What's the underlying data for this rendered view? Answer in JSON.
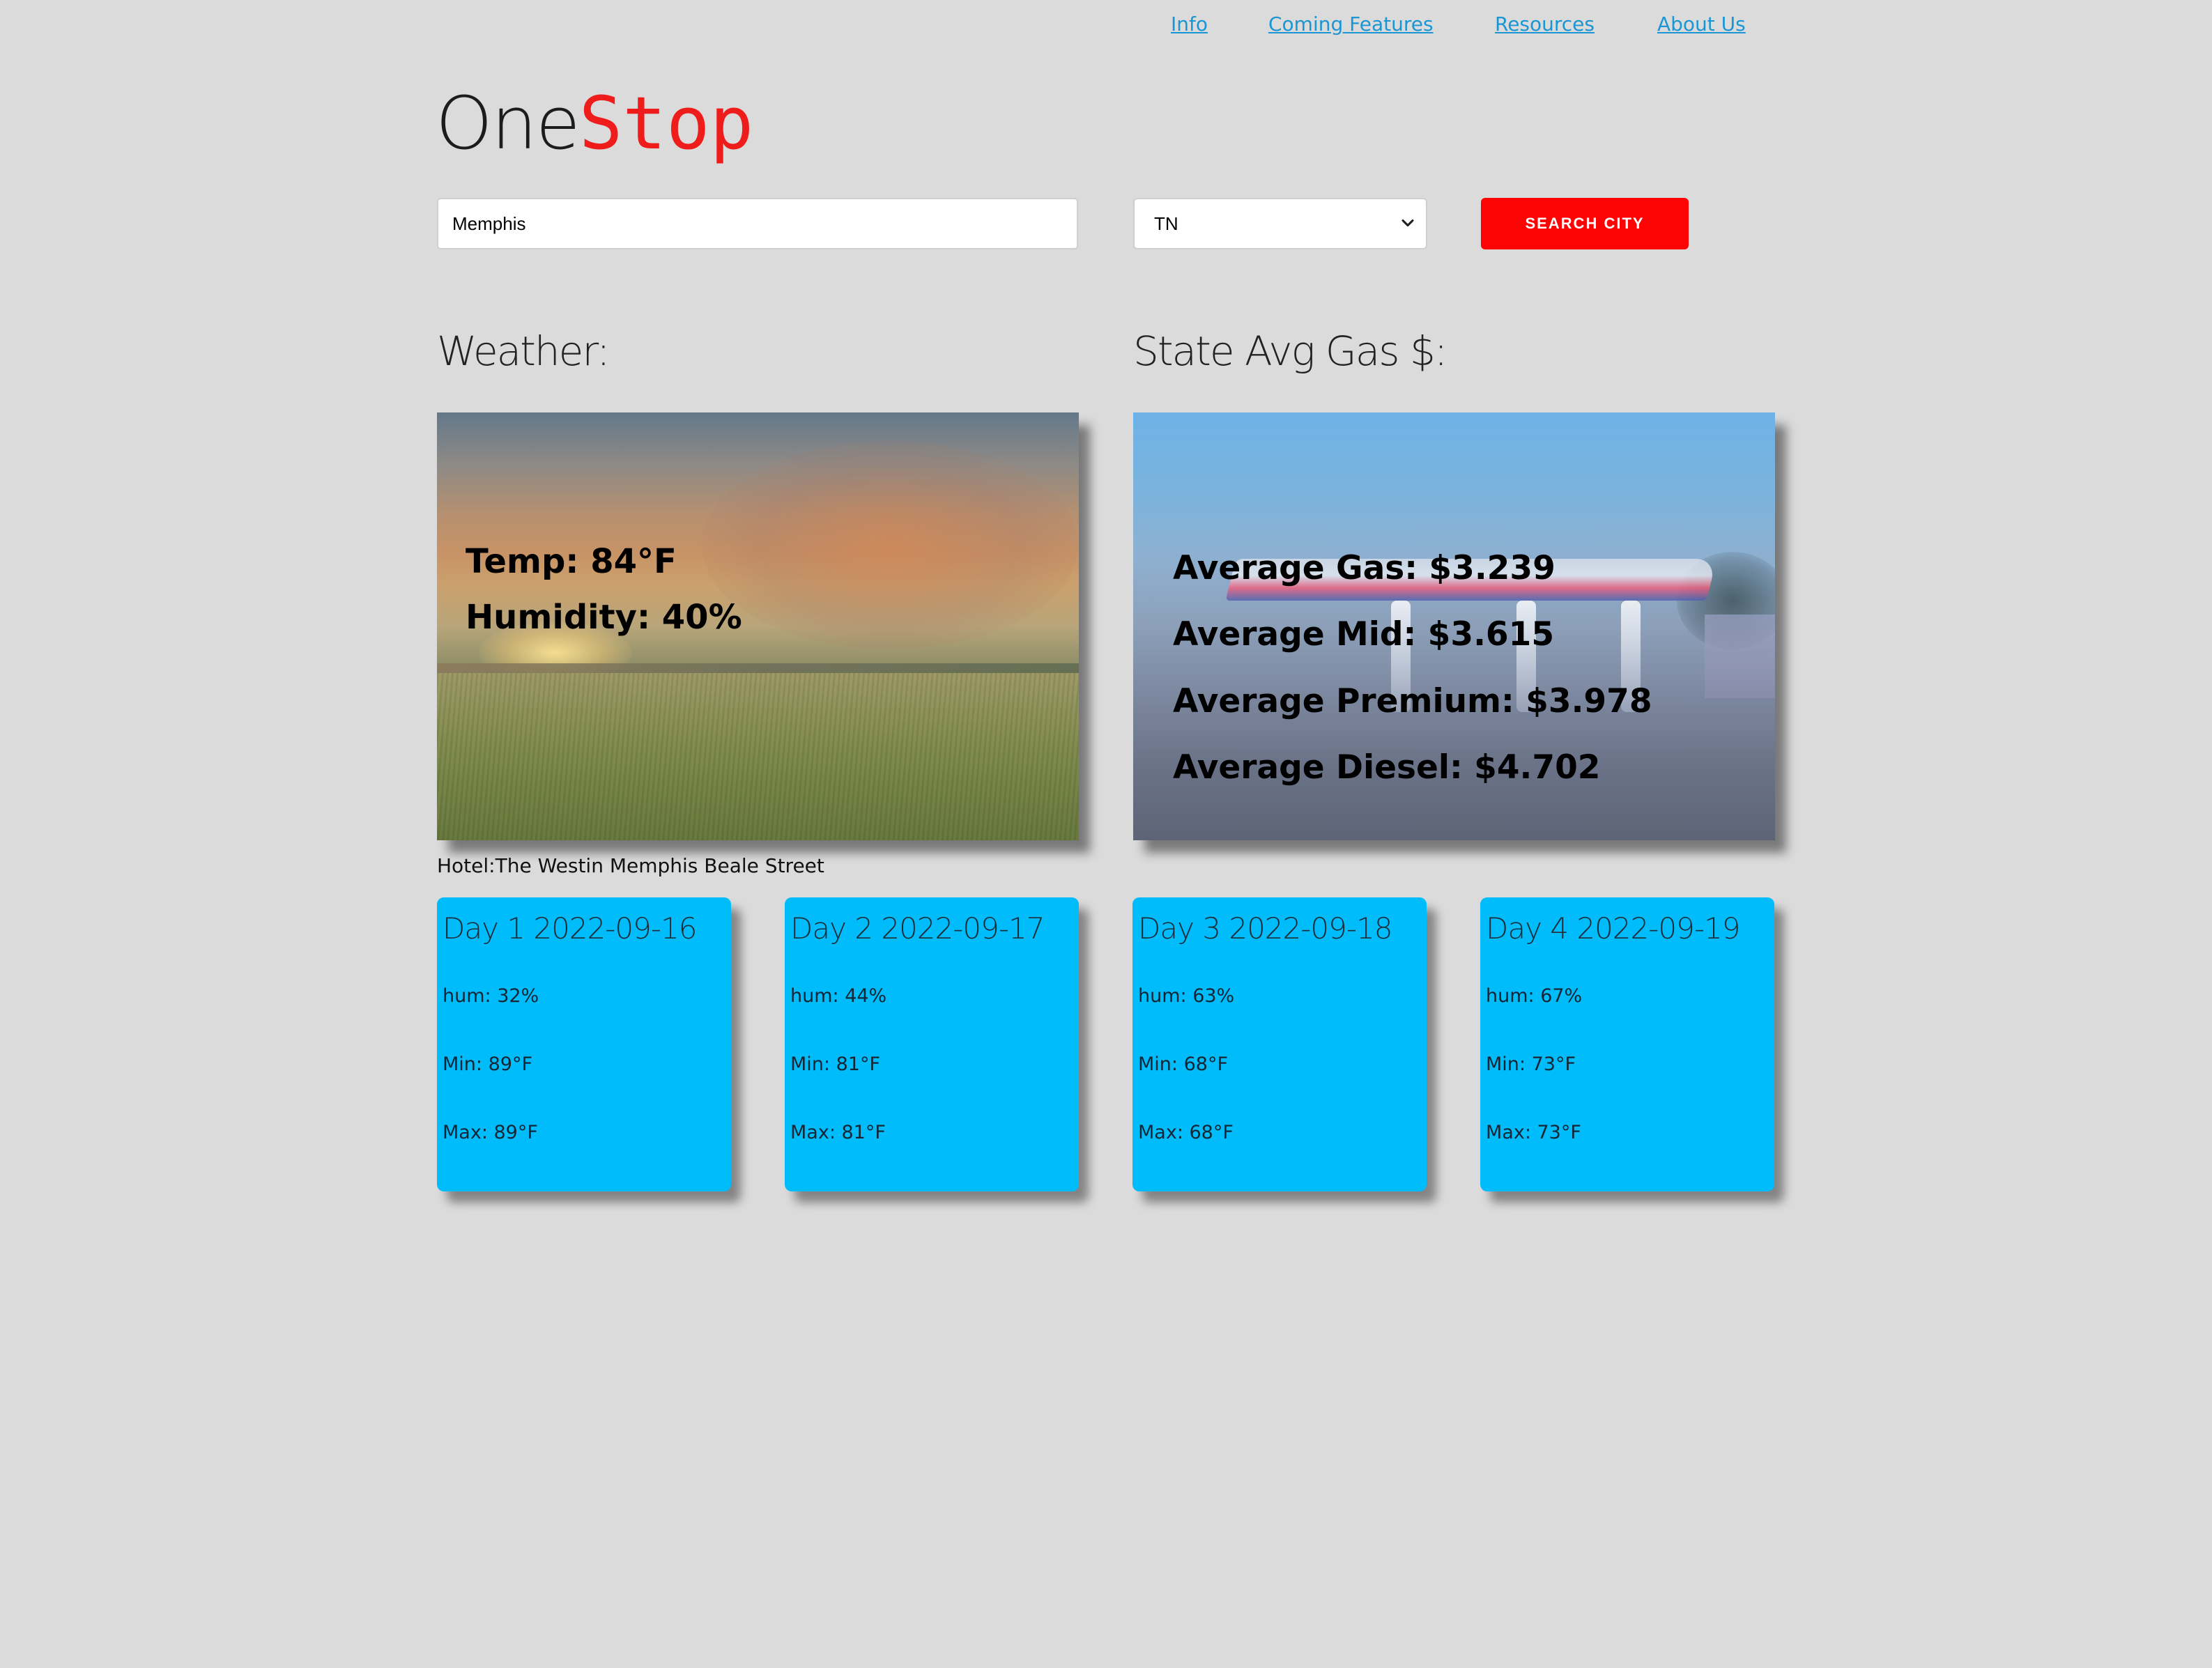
{
  "nav": {
    "items": [
      {
        "label": "Info"
      },
      {
        "label": "Coming Features"
      },
      {
        "label": "Resources"
      },
      {
        "label": "About Us"
      }
    ]
  },
  "logo": {
    "part1": "One",
    "part2": "Stop"
  },
  "search": {
    "city_value": "Memphis",
    "state_value": "TN",
    "button_label": "SEARCH CITY"
  },
  "weather": {
    "heading": "Weather:",
    "temp": "Temp: 84°F",
    "humidity": "Humidity: 40%"
  },
  "gas": {
    "heading": "State Avg Gas $:",
    "regular": "Average Gas: $3.239",
    "mid": "Average Mid: $3.615",
    "premium": "Average Premium: $3.978",
    "diesel": "Average Diesel: $4.702"
  },
  "hotel": "Hotel:The Westin Memphis Beale Street",
  "forecast": [
    {
      "title": "Day 1 2022-09-16",
      "hum": "hum: 32%",
      "min": "Min: 89°F",
      "max": "Max: 89°F"
    },
    {
      "title": "Day 2 2022-09-17",
      "hum": "hum: 44%",
      "min": "Min: 81°F",
      "max": "Max: 81°F"
    },
    {
      "title": "Day 3 2022-09-18",
      "hum": "hum: 63%",
      "min": "Min: 68°F",
      "max": "Max: 68°F"
    },
    {
      "title": "Day 4 2022-09-19",
      "hum": "hum: 67%",
      "min": "Min: 73°F",
      "max": "Max: 73°F"
    }
  ],
  "colors": {
    "background": "#dcdbdb",
    "link": "#1a96d4",
    "logo_accent": "#ef1c1c",
    "search_button": "#fd0404",
    "forecast_card": "#00bcfb"
  }
}
